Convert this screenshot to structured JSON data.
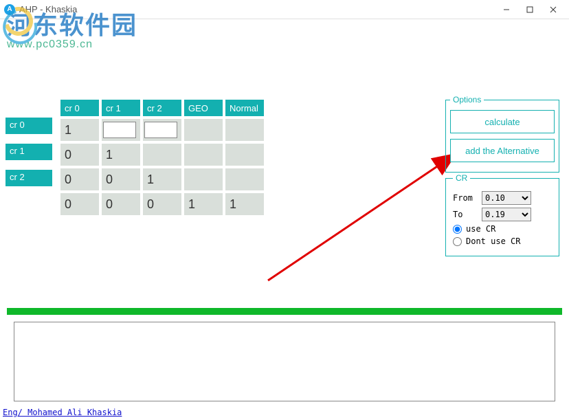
{
  "window": {
    "title": "AHP - Khaskia"
  },
  "watermark": {
    "big_text": "河东软件园",
    "url": "www.pc0359.cn"
  },
  "matrix": {
    "headers": [
      "cr 0",
      "cr 1",
      "cr 2",
      "GEO",
      "Normal"
    ],
    "row_labels": [
      "cr 0",
      "cr 1",
      "cr 2"
    ],
    "rows": [
      {
        "cells": [
          {
            "type": "val",
            "v": "1"
          },
          {
            "type": "input",
            "v": ""
          },
          {
            "type": "input",
            "v": ""
          },
          {
            "type": "val",
            "v": ""
          },
          {
            "type": "val",
            "v": ""
          }
        ]
      },
      {
        "cells": [
          {
            "type": "val",
            "v": "0"
          },
          {
            "type": "val",
            "v": "1"
          },
          {
            "type": "val",
            "v": ""
          },
          {
            "type": "val",
            "v": ""
          },
          {
            "type": "val",
            "v": ""
          }
        ]
      },
      {
        "cells": [
          {
            "type": "val",
            "v": "0"
          },
          {
            "type": "val",
            "v": "0"
          },
          {
            "type": "val",
            "v": "1"
          },
          {
            "type": "val",
            "v": ""
          },
          {
            "type": "val",
            "v": ""
          }
        ]
      },
      {
        "cells": [
          {
            "type": "val",
            "v": "0"
          },
          {
            "type": "val",
            "v": "0"
          },
          {
            "type": "val",
            "v": "0"
          },
          {
            "type": "val",
            "v": "1"
          },
          {
            "type": "val",
            "v": "1"
          }
        ]
      }
    ]
  },
  "options": {
    "legend": "Options",
    "calculate_label": "calculate",
    "add_alt_label": "add the Alternative"
  },
  "cr": {
    "legend": "CR",
    "from_label": "From",
    "from_value": "0.10",
    "from_options": [
      "0.10"
    ],
    "to_label": "To",
    "to_value": "0.19",
    "to_options": [
      "0.19"
    ],
    "use_label": "use CR",
    "dont_use_label": "Dont use CR",
    "selected": "use"
  },
  "bottom_text": "",
  "credit": "Eng/ Mohamed Ali Khaskia"
}
